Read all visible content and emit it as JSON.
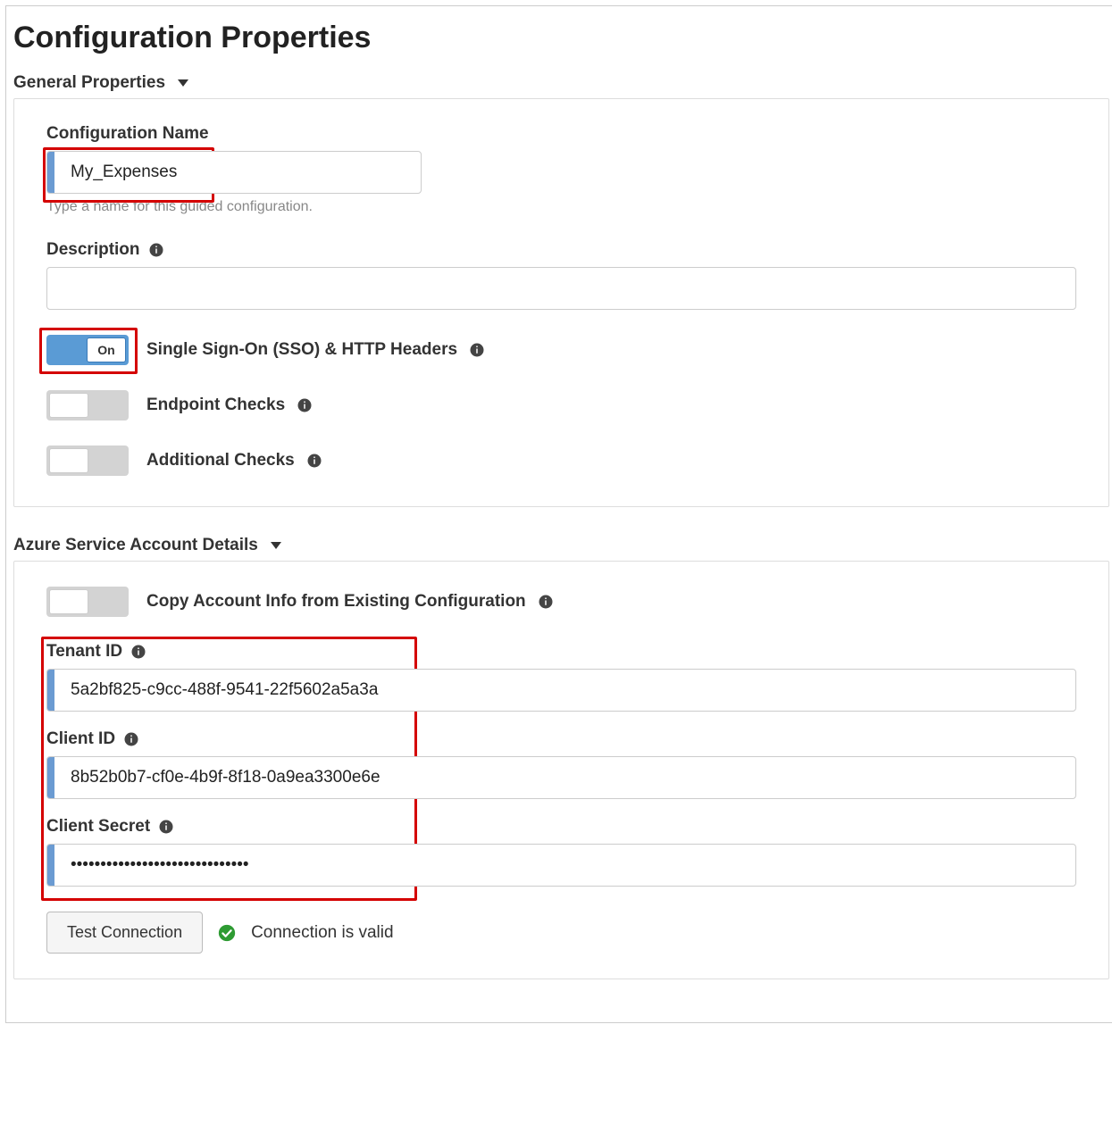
{
  "page": {
    "title": "Configuration Properties"
  },
  "sections": {
    "general": {
      "header": "General Properties",
      "config_name": {
        "label": "Configuration Name",
        "value": "My_Expenses",
        "help": "Type a name for this guided configuration."
      },
      "description": {
        "label": "Description",
        "value": ""
      },
      "sso": {
        "label": "Single Sign-On (SSO) & HTTP Headers",
        "state": "On"
      },
      "endpoint_checks": {
        "label": "Endpoint Checks",
        "state": "Off"
      },
      "additional_checks": {
        "label": "Additional Checks",
        "state": "Off"
      }
    },
    "azure": {
      "header": "Azure Service Account Details",
      "copy_existing": {
        "label": "Copy Account Info from Existing Configuration",
        "state": "Off"
      },
      "tenant_id": {
        "label": "Tenant ID",
        "value": "5a2bf825-c9cc-488f-9541-22f5602a5a3a"
      },
      "client_id": {
        "label": "Client ID",
        "value": "8b52b0b7-cf0e-4b9f-8f18-0a9ea3300e6e"
      },
      "client_secret": {
        "label": "Client Secret",
        "value": "••••••••••••••••••••••••••••••"
      },
      "test_button": "Test Connection",
      "status": "Connection is valid"
    }
  }
}
